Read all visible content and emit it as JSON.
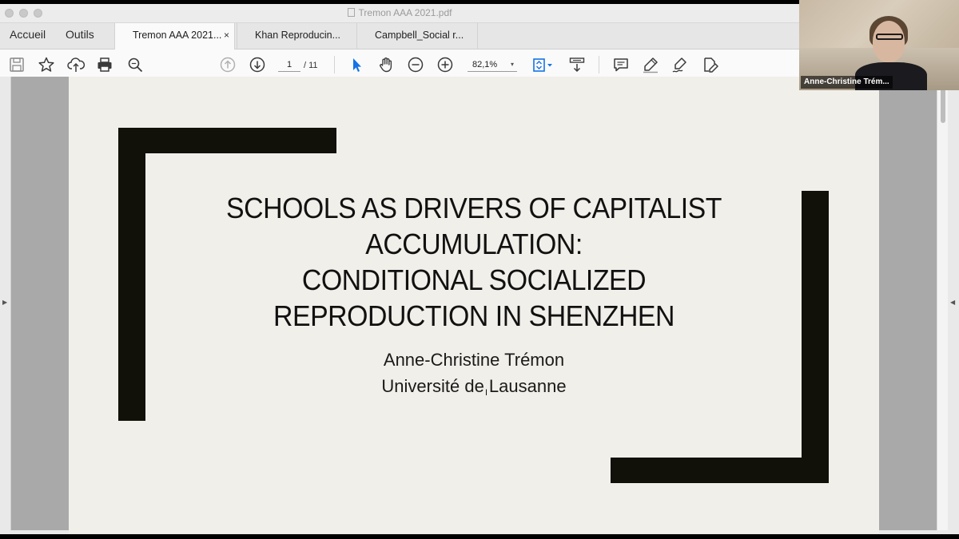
{
  "window": {
    "title": "Tremon AAA 2021.pdf"
  },
  "nav": {
    "home": "Accueil",
    "tools": "Outils"
  },
  "tabs": [
    {
      "label": "Tremon AAA 2021...",
      "close": "×"
    },
    {
      "label": "Khan Reproducin..."
    },
    {
      "label": "Campbell_Social r..."
    }
  ],
  "toolbar": {
    "page_current": "1",
    "page_total": "/ 11",
    "zoom": "82,1%",
    "zoom_caret": "▾"
  },
  "slide": {
    "title_lines": [
      "SCHOOLS AS DRIVERS OF CAPITALIST",
      "ACCUMULATION:",
      "CONDITIONAL SOCIALIZED",
      "REPRODUCTION IN SHENZHEN"
    ],
    "author": "Anne-Christine Trémon",
    "affiliation": "Université de Lausanne"
  },
  "video": {
    "participant_name": "Anne-Christine Trém..."
  },
  "colors": {
    "slide_bg": "#f1efe9",
    "frame": "#111009",
    "accent_icon": "#1473e6"
  },
  "icons": {
    "save": "save-icon",
    "bookmark": "star-icon",
    "upload": "cloud-upload-icon",
    "print": "print-icon",
    "find": "search-icon",
    "prev_page": "arrow-up-circle-icon",
    "next_page": "arrow-down-circle-icon",
    "select": "cursor-arrow-icon",
    "hand": "hand-icon",
    "zoom_out": "zoom-out-icon",
    "zoom_in": "zoom-in-icon",
    "fit": "fit-page-icon",
    "scroll_mode": "scroll-mode-icon",
    "comment": "comment-icon",
    "highlight": "highlighter-icon",
    "sign": "sign-icon",
    "edit": "edit-pdf-icon"
  }
}
